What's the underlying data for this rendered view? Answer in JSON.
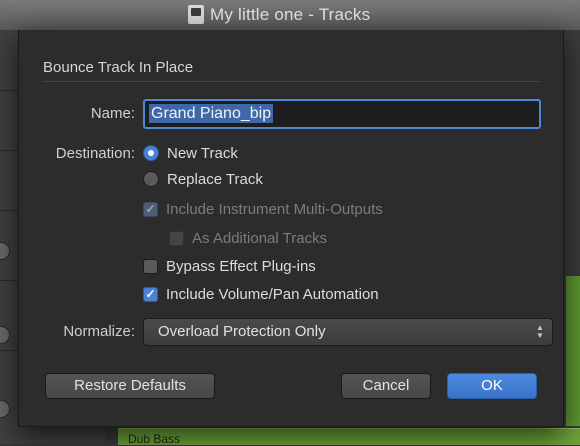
{
  "window": {
    "title": "My little one - Tracks"
  },
  "background": {
    "region_label": "Dub Bass"
  },
  "dialog": {
    "title": "Bounce Track In Place",
    "name_label": "Name:",
    "name_value": "Grand Piano_bip",
    "destination_label": "Destination:",
    "options": {
      "new_track": "New Track",
      "replace_track": "Replace Track",
      "include_multi_outputs": "Include Instrument Multi-Outputs",
      "as_additional_tracks": "As Additional Tracks",
      "bypass_effects": "Bypass Effect Plug-ins",
      "include_automation": "Include Volume/Pan Automation"
    },
    "state": {
      "destination": "New Track",
      "include_multi_outputs": true,
      "as_additional_tracks": false,
      "bypass_effects": false,
      "include_automation": true
    },
    "normalize_label": "Normalize:",
    "normalize_value": "Overload Protection Only",
    "buttons": {
      "restore": "Restore Defaults",
      "cancel": "Cancel",
      "ok": "OK"
    },
    "colors": {
      "accent": "#4a82d4",
      "dialog_bg": "#2c2c2c"
    }
  }
}
